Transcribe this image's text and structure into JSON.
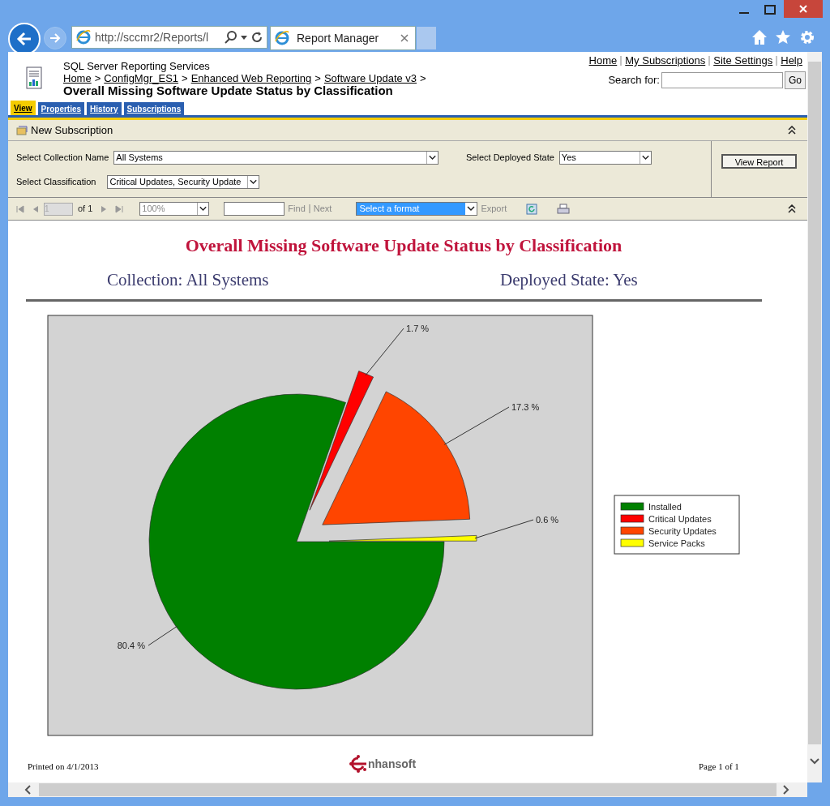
{
  "browser": {
    "address": "http://sccmr2/Reports/l",
    "tab_title": "Report Manager"
  },
  "header": {
    "product": "SQL Server Reporting Services",
    "breadcrumbs": [
      "Home",
      "ConfigMgr_ES1",
      "Enhanced Web Reporting",
      "Software Update v3"
    ],
    "separator": ">",
    "title": "Overall Missing Software Update Status by Classification",
    "links": [
      "Home",
      "My Subscriptions",
      "Site Settings",
      "Help"
    ],
    "search_label": "Search for:",
    "search_button": "Go"
  },
  "tabs": [
    {
      "label": "View",
      "selected": true
    },
    {
      "label": "Properties",
      "selected": false
    },
    {
      "label": "History",
      "selected": false
    },
    {
      "label": "Subscriptions",
      "selected": false
    }
  ],
  "new_subscription": "New Subscription",
  "parameters": [
    {
      "label": "Select Collection Name",
      "value": "All Systems"
    },
    {
      "label": "Select Deployed State",
      "value": "Yes"
    },
    {
      "label": "Select Classification",
      "value": "Critical Updates, Security Update"
    }
  ],
  "view_report": "View Report",
  "toolbar": {
    "page": "1",
    "of": "of 1",
    "zoom": "100%",
    "find": "Find",
    "next": "Next",
    "format": "Select a format",
    "export": "Export"
  },
  "report": {
    "title": "Overall Missing Software Update Status by Classification",
    "collection": "Collection: All Systems",
    "deployed": "Deployed State: Yes",
    "chart_data": {
      "type": "pie",
      "categories": [
        "Installed",
        "Critical Updates",
        "Security Updates",
        "Service Packs"
      ],
      "values": [
        80.4,
        1.7,
        17.3,
        0.6
      ],
      "colors": [
        "#008000",
        "#ff0000",
        "#ff4500",
        "#ffff00"
      ],
      "value_labels": [
        "80.4 %",
        "1.7 %",
        "17.3 %",
        "0.6 %"
      ],
      "legend": true
    },
    "printed": "Printed on 4/1/2013",
    "logo": "nhansoft",
    "page": "Page 1 of 1"
  }
}
